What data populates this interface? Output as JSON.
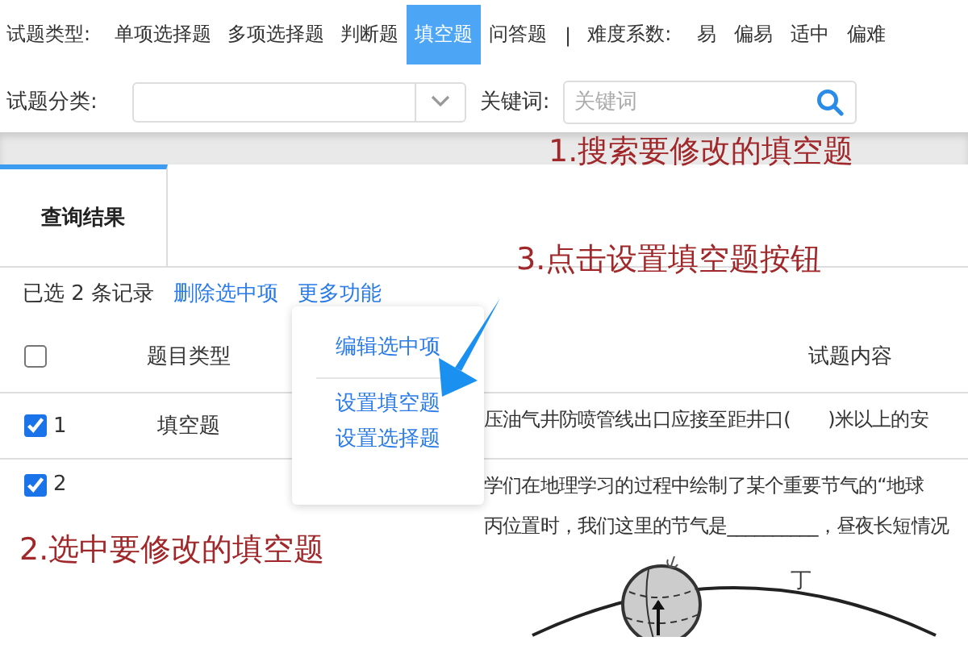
{
  "filters": {
    "type_label": "试题类型:",
    "types": [
      {
        "label": "单项选择题",
        "selected": false
      },
      {
        "label": "多项选择题",
        "selected": false
      },
      {
        "label": "判断题",
        "selected": false
      },
      {
        "label": "填空题",
        "selected": true
      },
      {
        "label": "问答题",
        "selected": false
      }
    ],
    "separator": "|",
    "difficulty_label": "难度系数:",
    "difficulties": [
      "易",
      "偏易",
      "适中",
      "偏难"
    ],
    "category_label": "试题分类:",
    "keyword_label": "关键词:",
    "keyword_placeholder": "关键词"
  },
  "tabs": [
    {
      "label": "查询结果",
      "selected": true
    }
  ],
  "toolbar": {
    "selection": "已选 2 条记录",
    "links": [
      "删除选中项",
      "更多功能"
    ]
  },
  "menu": {
    "items": [
      "编辑选中项",
      "设置填空题",
      "设置选择题"
    ]
  },
  "table": {
    "header_checked": false,
    "columns": [
      "题目类型",
      "试题内容"
    ],
    "rows": [
      {
        "checked": true,
        "number": "1",
        "type": "填空题",
        "content": [
          "压油气井防喷管线出口应接至距井口(　　)米以上的安"
        ]
      },
      {
        "checked": true,
        "number": "2",
        "type": "",
        "content": [
          "学们在地理学习的过程中绘制了某个重要节气的“地球",
          "丙位置时，我们这里的节气是__________，昼夜长短情况"
        ],
        "figure_label": "丁"
      }
    ]
  },
  "annotations": [
    "1.搜索要修改的填空题",
    "3.点击设置填空题按钮",
    "2.选中要修改的填空题"
  ]
}
